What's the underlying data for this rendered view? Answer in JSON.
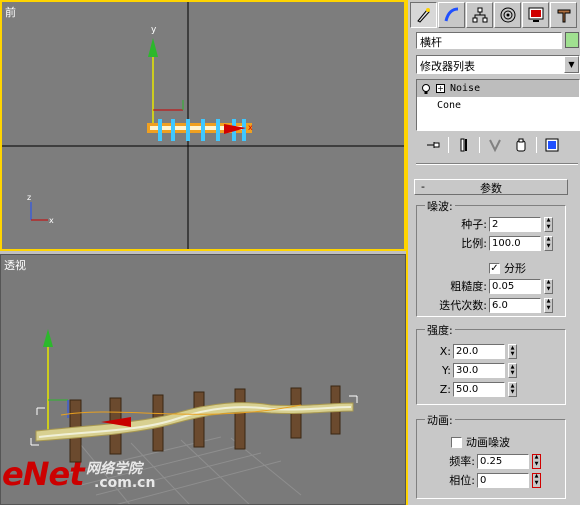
{
  "viewports": {
    "front": {
      "label": "前",
      "axis_y": "y",
      "axis_z": "z",
      "axis_x": "x",
      "gizmo_x": "x"
    },
    "perspective": {
      "label": "透视"
    }
  },
  "panel": {
    "tabs": [
      {
        "icon": "create-icon",
        "active": true
      },
      {
        "icon": "modify-icon",
        "active": false
      },
      {
        "icon": "hierarchy-icon",
        "active": false
      },
      {
        "icon": "motion-icon",
        "active": false
      },
      {
        "icon": "display-icon",
        "active": false
      },
      {
        "icon": "utilities-icon",
        "active": false
      }
    ],
    "object_name": "横杆",
    "object_color": "#a0e090",
    "modifier_list": "修改器列表",
    "stack": [
      {
        "label": "Noise",
        "selected": true,
        "expandable": true
      },
      {
        "label": "Cone",
        "selected": false,
        "expandable": false
      }
    ],
    "rollout": {
      "collapse": "-",
      "title": "参数",
      "noise": {
        "title": "噪波:",
        "seed_label": "种子:",
        "seed": "2",
        "scale_label": "比例:",
        "scale": "100.0",
        "fractal_label": "分形",
        "fractal_checked": true,
        "roughness_label": "粗糙度:",
        "roughness": "0.05",
        "iterations_label": "迭代次数:",
        "iterations": "6.0"
      },
      "strength": {
        "title": "强度:",
        "x_label": "X:",
        "x": "20.0",
        "y_label": "Y:",
        "y": "30.0",
        "z_label": "Z:",
        "z": "50.0"
      },
      "animation": {
        "title": "动画:",
        "animate_label": "动画噪波",
        "animate_checked": false,
        "freq_label": "频率:",
        "freq": "0.25",
        "phase_label": "相位:",
        "phase": "0"
      }
    }
  },
  "watermark": {
    "brand": "eNet",
    "cn": "网络学院",
    "domain": ".com.cn"
  }
}
